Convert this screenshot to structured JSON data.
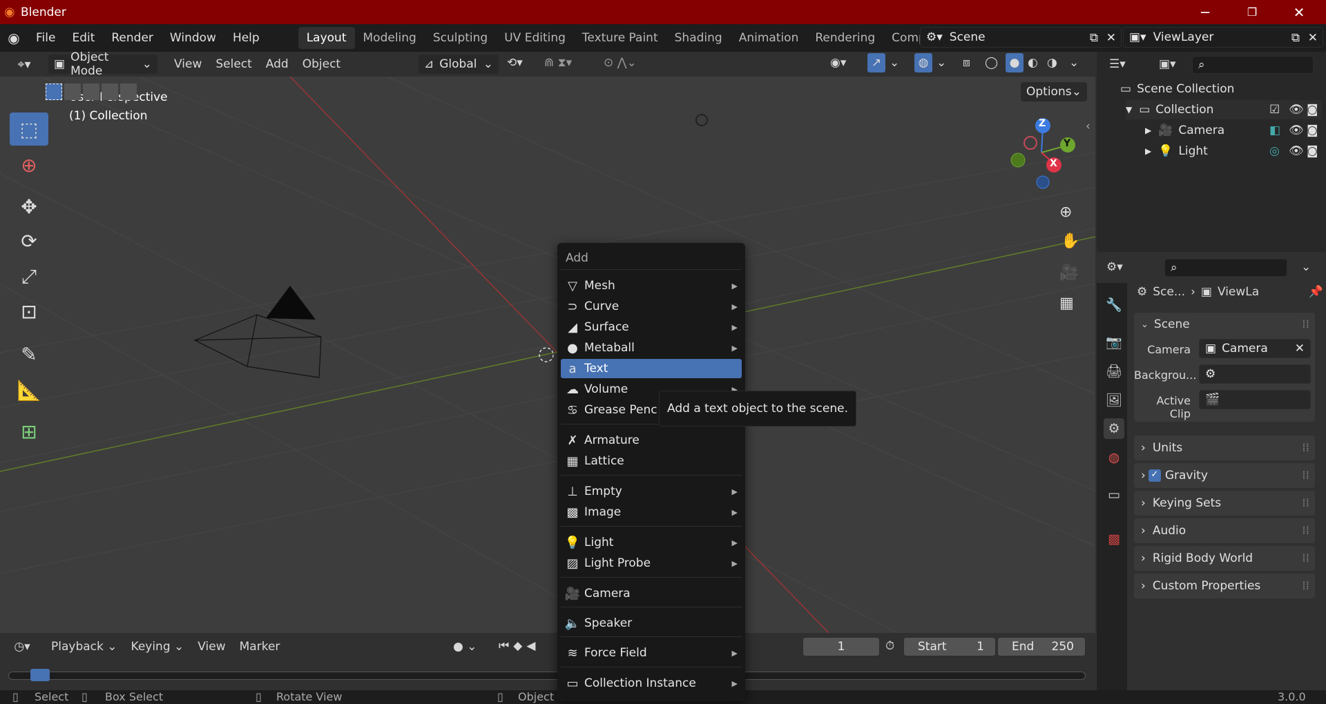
{
  "window": {
    "title": "Blender",
    "version": "3.0.0"
  },
  "menus": [
    "File",
    "Edit",
    "Render",
    "Window",
    "Help"
  ],
  "workspaces": [
    "Layout",
    "Modeling",
    "Sculpting",
    "UV Editing",
    "Texture Paint",
    "Shading",
    "Animation",
    "Rendering",
    "Compo"
  ],
  "active_workspace": "Layout",
  "scene_name": "Scene",
  "view_layer": "ViewLayer",
  "viewport_header": {
    "mode": "Object Mode",
    "menus": [
      "View",
      "Select",
      "Add",
      "Object"
    ],
    "orientation": "Global",
    "options": "Options"
  },
  "viewport": {
    "perspective": "User Perspective",
    "collection": "(1) Collection"
  },
  "gizmo": {
    "x": "X",
    "y": "Y",
    "z": "Z"
  },
  "outliner": {
    "scene_collection": "Scene Collection",
    "collection": "Collection",
    "items": [
      "Camera",
      "Light"
    ]
  },
  "properties": {
    "breadcrumb_scene": "Sce...",
    "breadcrumb_viewlayer": "ViewLa",
    "section": "Scene",
    "fields": [
      {
        "label": "Camera",
        "value": "Camera"
      },
      {
        "label": "Backgrou...",
        "value": ""
      },
      {
        "label": "Active Clip",
        "value": ""
      }
    ],
    "panels": [
      "Units",
      "Gravity",
      "Keying Sets",
      "Audio",
      "Rigid Body World",
      "Custom Properties"
    ]
  },
  "add_menu": {
    "title": "Add",
    "items": [
      {
        "label": "Mesh",
        "icon": "mesh-icon",
        "submenu": true
      },
      {
        "label": "Curve",
        "icon": "curve-icon",
        "submenu": true
      },
      {
        "label": "Surface",
        "icon": "surface-icon",
        "submenu": true
      },
      {
        "label": "Metaball",
        "icon": "metaball-icon",
        "submenu": true
      },
      {
        "label": "Text",
        "icon": "text-icon",
        "submenu": false,
        "highlighted": true
      },
      {
        "label": "Volume",
        "icon": "volume-icon",
        "submenu": true
      },
      {
        "label": "Grease Penc",
        "icon": "grease-pencil-icon",
        "submenu": true
      },
      {
        "label": "Armature",
        "icon": "armature-icon",
        "submenu": false
      },
      {
        "label": "Lattice",
        "icon": "lattice-icon",
        "submenu": false
      },
      {
        "label": "Empty",
        "icon": "empty-icon",
        "submenu": true
      },
      {
        "label": "Image",
        "icon": "image-icon",
        "submenu": true
      },
      {
        "label": "Light",
        "icon": "light-icon",
        "submenu": true
      },
      {
        "label": "Light Probe",
        "icon": "light-probe-icon",
        "submenu": true
      },
      {
        "label": "Camera",
        "icon": "camera-icon",
        "submenu": false
      },
      {
        "label": "Speaker",
        "icon": "speaker-icon",
        "submenu": false
      },
      {
        "label": "Force Field",
        "icon": "force-field-icon",
        "submenu": true
      },
      {
        "label": "Collection Instance",
        "icon": "collection-instance-icon",
        "submenu": true
      }
    ],
    "tooltip": "Add a text object to the scene."
  },
  "timeline": {
    "menus": [
      "Playback",
      "Keying",
      "View",
      "Marker"
    ],
    "frame": "1",
    "start_label": "Start",
    "start": "1",
    "end_label": "End",
    "end": "250"
  },
  "statusbar": {
    "select": "Select",
    "box_select": "Box Select",
    "rotate_view": "Rotate View",
    "object_menu": "Object"
  }
}
